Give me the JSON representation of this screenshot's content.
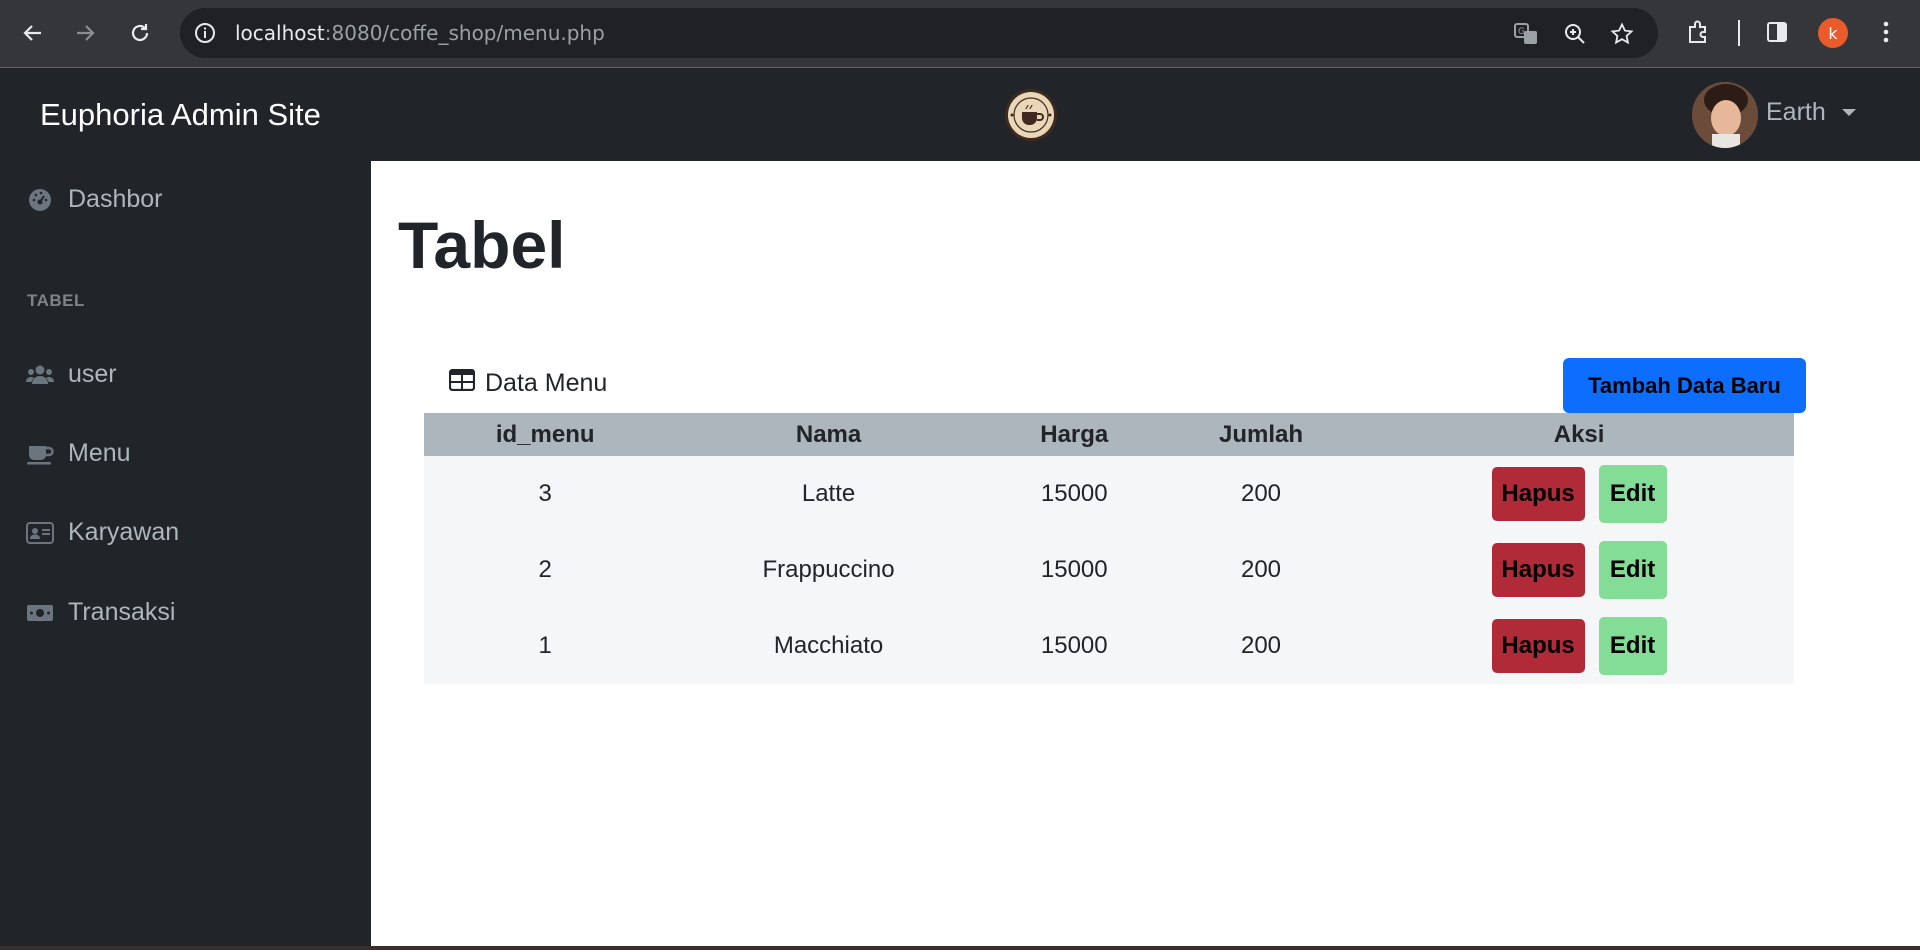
{
  "browser": {
    "url_host": "localhost",
    "url_path": ":8080/coffe_shop/menu.php",
    "profile_initial": "k"
  },
  "navbar": {
    "brand": "Euphoria Admin Site",
    "user_name": "Earth"
  },
  "sidebar": {
    "items": [
      {
        "label": "Dashbor",
        "icon": "gauge-icon"
      },
      {
        "label": "user",
        "icon": "users-icon"
      },
      {
        "label": "Menu",
        "icon": "coffee-icon"
      },
      {
        "label": "Karyawan",
        "icon": "id-card-icon"
      },
      {
        "label": "Transaksi",
        "icon": "money-bill-icon"
      }
    ],
    "section_heading": "TABEL"
  },
  "main": {
    "title": "Tabel",
    "card_title": "Data Menu",
    "add_button": "Tambah Data Baru",
    "table": {
      "headers": [
        "id_menu",
        "Nama",
        "Harga",
        "Jumlah",
        "Aksi"
      ],
      "rows": [
        {
          "id_menu": "3",
          "nama": "Latte",
          "harga": "15000",
          "jumlah": "200"
        },
        {
          "id_menu": "2",
          "nama": "Frappuccino",
          "harga": "15000",
          "jumlah": "200"
        },
        {
          "id_menu": "1",
          "nama": "Macchiato",
          "harga": "15000",
          "jumlah": "200"
        }
      ],
      "delete_label": "Hapus",
      "edit_label": "Edit"
    }
  },
  "colors": {
    "primary_button": "#0d6efd",
    "delete_button": "#b02a37",
    "edit_button": "#84dd96",
    "dark_bg": "#212529"
  }
}
